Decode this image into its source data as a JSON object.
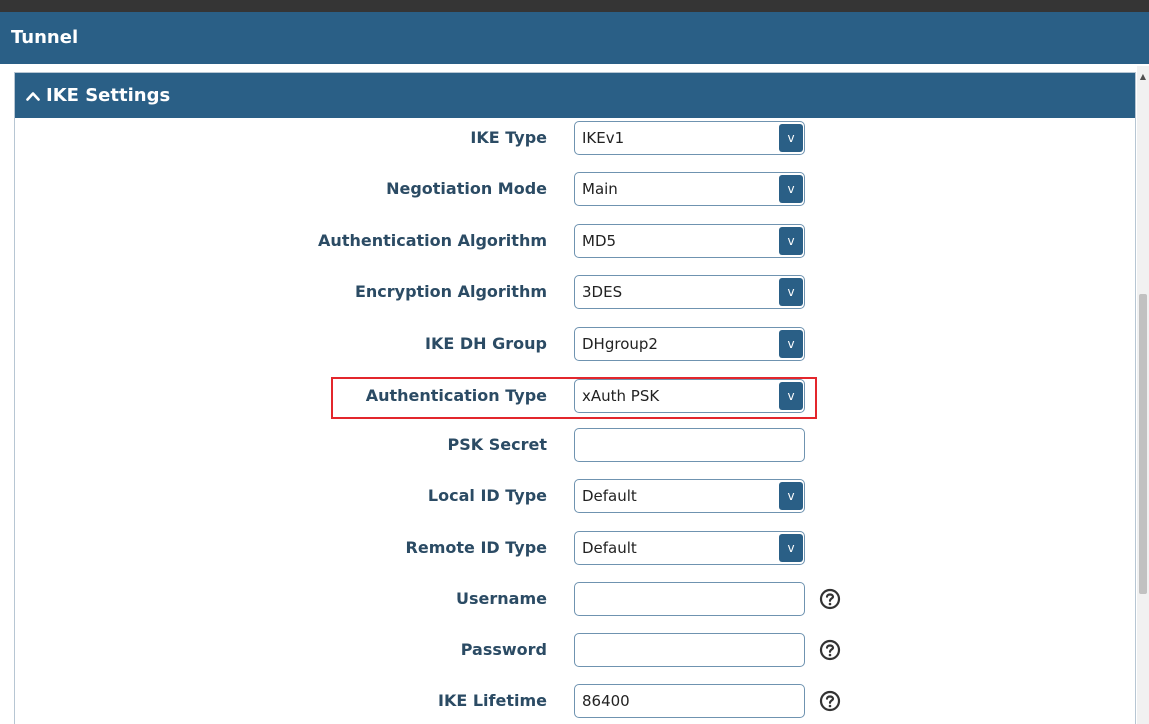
{
  "tunnel_title": "Tunnel",
  "section_title": "IKE Settings",
  "fields": {
    "ike_type": {
      "label": "IKE Type",
      "value": "IKEv1"
    },
    "negotiation_mode": {
      "label": "Negotiation Mode",
      "value": "Main"
    },
    "auth_algorithm": {
      "label": "Authentication Algorithm",
      "value": "MD5"
    },
    "encryption_algorithm": {
      "label": "Encryption Algorithm",
      "value": "3DES"
    },
    "ike_dh_group": {
      "label": "IKE DH Group",
      "value": "DHgroup2"
    },
    "auth_type": {
      "label": "Authentication Type",
      "value": "xAuth PSK"
    },
    "psk_secret": {
      "label": "PSK Secret",
      "value": ""
    },
    "local_id_type": {
      "label": "Local ID Type",
      "value": "Default"
    },
    "remote_id_type": {
      "label": "Remote ID Type",
      "value": "Default"
    },
    "username": {
      "label": "Username",
      "value": ""
    },
    "password": {
      "label": "Password",
      "value": ""
    },
    "ike_lifetime": {
      "label": "IKE Lifetime",
      "value": "86400"
    }
  },
  "dropdown_glyph": "v",
  "icons": {
    "section_toggle": "caret-up-icon",
    "help": "help-icon"
  },
  "colors": {
    "header_bg": "#2a5f86",
    "label_text": "#2b4b64",
    "highlight": "#e3262c"
  }
}
